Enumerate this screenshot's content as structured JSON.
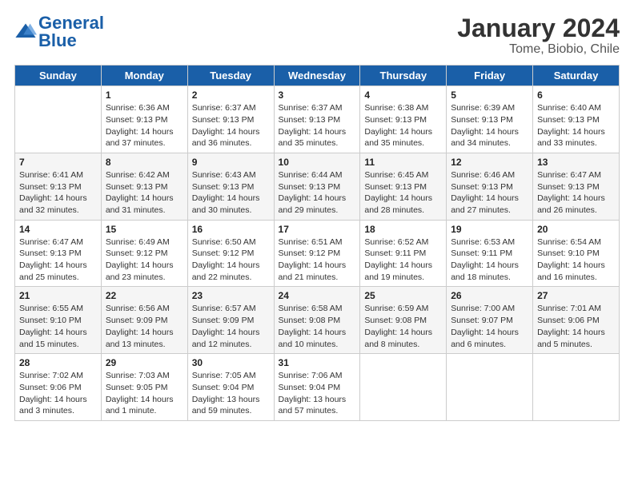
{
  "header": {
    "logo_general": "General",
    "logo_blue": "Blue",
    "main_title": "January 2024",
    "subtitle": "Tome, Biobio, Chile"
  },
  "days_of_week": [
    "Sunday",
    "Monday",
    "Tuesday",
    "Wednesday",
    "Thursday",
    "Friday",
    "Saturday"
  ],
  "weeks": [
    [
      {
        "day": "",
        "sunrise": "",
        "sunset": "",
        "daylight": ""
      },
      {
        "day": "1",
        "sunrise": "Sunrise: 6:36 AM",
        "sunset": "Sunset: 9:13 PM",
        "daylight": "Daylight: 14 hours and 37 minutes."
      },
      {
        "day": "2",
        "sunrise": "Sunrise: 6:37 AM",
        "sunset": "Sunset: 9:13 PM",
        "daylight": "Daylight: 14 hours and 36 minutes."
      },
      {
        "day": "3",
        "sunrise": "Sunrise: 6:37 AM",
        "sunset": "Sunset: 9:13 PM",
        "daylight": "Daylight: 14 hours and 35 minutes."
      },
      {
        "day": "4",
        "sunrise": "Sunrise: 6:38 AM",
        "sunset": "Sunset: 9:13 PM",
        "daylight": "Daylight: 14 hours and 35 minutes."
      },
      {
        "day": "5",
        "sunrise": "Sunrise: 6:39 AM",
        "sunset": "Sunset: 9:13 PM",
        "daylight": "Daylight: 14 hours and 34 minutes."
      },
      {
        "day": "6",
        "sunrise": "Sunrise: 6:40 AM",
        "sunset": "Sunset: 9:13 PM",
        "daylight": "Daylight: 14 hours and 33 minutes."
      }
    ],
    [
      {
        "day": "7",
        "sunrise": "Sunrise: 6:41 AM",
        "sunset": "Sunset: 9:13 PM",
        "daylight": "Daylight: 14 hours and 32 minutes."
      },
      {
        "day": "8",
        "sunrise": "Sunrise: 6:42 AM",
        "sunset": "Sunset: 9:13 PM",
        "daylight": "Daylight: 14 hours and 31 minutes."
      },
      {
        "day": "9",
        "sunrise": "Sunrise: 6:43 AM",
        "sunset": "Sunset: 9:13 PM",
        "daylight": "Daylight: 14 hours and 30 minutes."
      },
      {
        "day": "10",
        "sunrise": "Sunrise: 6:44 AM",
        "sunset": "Sunset: 9:13 PM",
        "daylight": "Daylight: 14 hours and 29 minutes."
      },
      {
        "day": "11",
        "sunrise": "Sunrise: 6:45 AM",
        "sunset": "Sunset: 9:13 PM",
        "daylight": "Daylight: 14 hours and 28 minutes."
      },
      {
        "day": "12",
        "sunrise": "Sunrise: 6:46 AM",
        "sunset": "Sunset: 9:13 PM",
        "daylight": "Daylight: 14 hours and 27 minutes."
      },
      {
        "day": "13",
        "sunrise": "Sunrise: 6:47 AM",
        "sunset": "Sunset: 9:13 PM",
        "daylight": "Daylight: 14 hours and 26 minutes."
      }
    ],
    [
      {
        "day": "14",
        "sunrise": "Sunrise: 6:47 AM",
        "sunset": "Sunset: 9:13 PM",
        "daylight": "Daylight: 14 hours and 25 minutes."
      },
      {
        "day": "15",
        "sunrise": "Sunrise: 6:49 AM",
        "sunset": "Sunset: 9:12 PM",
        "daylight": "Daylight: 14 hours and 23 minutes."
      },
      {
        "day": "16",
        "sunrise": "Sunrise: 6:50 AM",
        "sunset": "Sunset: 9:12 PM",
        "daylight": "Daylight: 14 hours and 22 minutes."
      },
      {
        "day": "17",
        "sunrise": "Sunrise: 6:51 AM",
        "sunset": "Sunset: 9:12 PM",
        "daylight": "Daylight: 14 hours and 21 minutes."
      },
      {
        "day": "18",
        "sunrise": "Sunrise: 6:52 AM",
        "sunset": "Sunset: 9:11 PM",
        "daylight": "Daylight: 14 hours and 19 minutes."
      },
      {
        "day": "19",
        "sunrise": "Sunrise: 6:53 AM",
        "sunset": "Sunset: 9:11 PM",
        "daylight": "Daylight: 14 hours and 18 minutes."
      },
      {
        "day": "20",
        "sunrise": "Sunrise: 6:54 AM",
        "sunset": "Sunset: 9:10 PM",
        "daylight": "Daylight: 14 hours and 16 minutes."
      }
    ],
    [
      {
        "day": "21",
        "sunrise": "Sunrise: 6:55 AM",
        "sunset": "Sunset: 9:10 PM",
        "daylight": "Daylight: 14 hours and 15 minutes."
      },
      {
        "day": "22",
        "sunrise": "Sunrise: 6:56 AM",
        "sunset": "Sunset: 9:09 PM",
        "daylight": "Daylight: 14 hours and 13 minutes."
      },
      {
        "day": "23",
        "sunrise": "Sunrise: 6:57 AM",
        "sunset": "Sunset: 9:09 PM",
        "daylight": "Daylight: 14 hours and 12 minutes."
      },
      {
        "day": "24",
        "sunrise": "Sunrise: 6:58 AM",
        "sunset": "Sunset: 9:08 PM",
        "daylight": "Daylight: 14 hours and 10 minutes."
      },
      {
        "day": "25",
        "sunrise": "Sunrise: 6:59 AM",
        "sunset": "Sunset: 9:08 PM",
        "daylight": "Daylight: 14 hours and 8 minutes."
      },
      {
        "day": "26",
        "sunrise": "Sunrise: 7:00 AM",
        "sunset": "Sunset: 9:07 PM",
        "daylight": "Daylight: 14 hours and 6 minutes."
      },
      {
        "day": "27",
        "sunrise": "Sunrise: 7:01 AM",
        "sunset": "Sunset: 9:06 PM",
        "daylight": "Daylight: 14 hours and 5 minutes."
      }
    ],
    [
      {
        "day": "28",
        "sunrise": "Sunrise: 7:02 AM",
        "sunset": "Sunset: 9:06 PM",
        "daylight": "Daylight: 14 hours and 3 minutes."
      },
      {
        "day": "29",
        "sunrise": "Sunrise: 7:03 AM",
        "sunset": "Sunset: 9:05 PM",
        "daylight": "Daylight: 14 hours and 1 minute."
      },
      {
        "day": "30",
        "sunrise": "Sunrise: 7:05 AM",
        "sunset": "Sunset: 9:04 PM",
        "daylight": "Daylight: 13 hours and 59 minutes."
      },
      {
        "day": "31",
        "sunrise": "Sunrise: 7:06 AM",
        "sunset": "Sunset: 9:04 PM",
        "daylight": "Daylight: 13 hours and 57 minutes."
      },
      {
        "day": "",
        "sunrise": "",
        "sunset": "",
        "daylight": ""
      },
      {
        "day": "",
        "sunrise": "",
        "sunset": "",
        "daylight": ""
      },
      {
        "day": "",
        "sunrise": "",
        "sunset": "",
        "daylight": ""
      }
    ]
  ]
}
